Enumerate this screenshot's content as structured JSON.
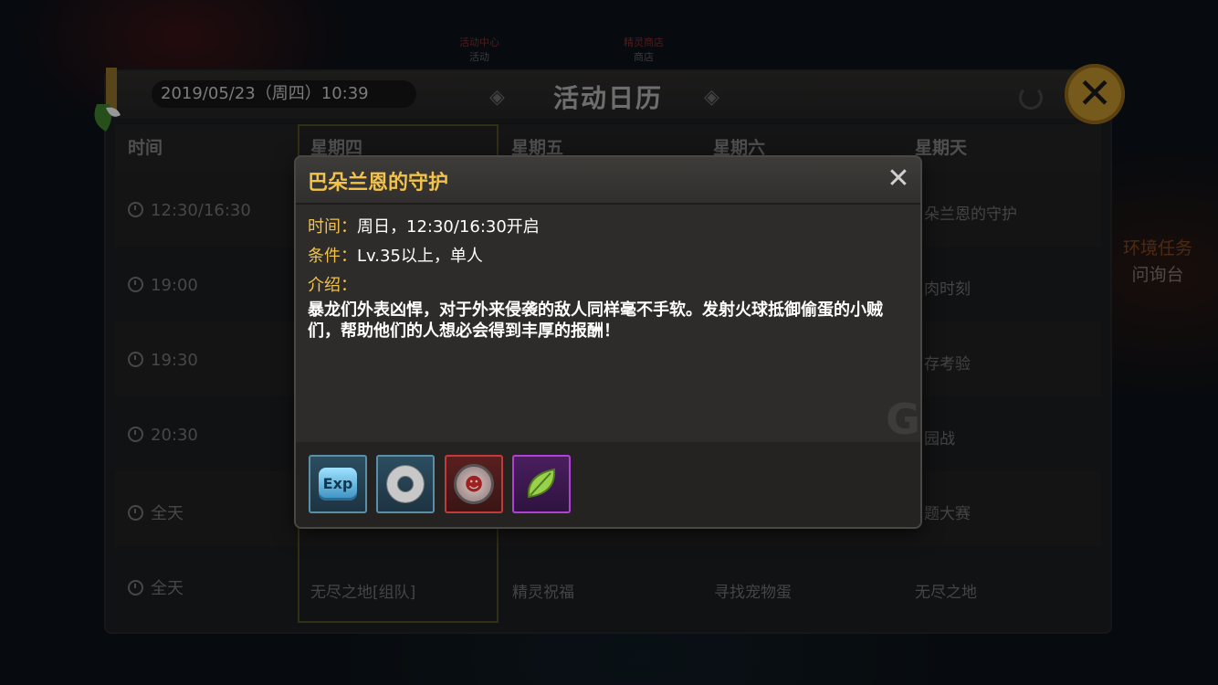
{
  "background": {
    "top_tabs": [
      {
        "line1": "活动中心",
        "line2": "活动"
      },
      {
        "line1": "精灵商店",
        "line2": "商店"
      }
    ],
    "side_button": {
      "line1": "环境任务",
      "line2": "问询台"
    }
  },
  "calendar": {
    "date": "2019/05/23（周四）10:39",
    "title": "活动日历",
    "columns": [
      "时间",
      "星期四",
      "星期五",
      "星期六",
      "星期天"
    ],
    "rows": [
      {
        "time": "12:30/16:30",
        "thu": "",
        "fri": "",
        "sat": "",
        "sun": "巴朵兰恩的守护"
      },
      {
        "time": "19:00",
        "thu": "",
        "fri": "",
        "sat": "",
        "sun": "烤肉时刻"
      },
      {
        "time": "19:30",
        "thu": "",
        "fri": "",
        "sat": "",
        "sun": "生存考验"
      },
      {
        "time": "20:30",
        "thu": "",
        "fri": "",
        "sat": "",
        "sun": "乐园战"
      },
      {
        "time": "全天",
        "thu": "",
        "fri": "",
        "sat": "",
        "sun": "问题大赛"
      },
      {
        "time": "全天",
        "thu": "无尽之地[组队]",
        "fri": "精灵祝福",
        "sat": "寻找宠物蛋",
        "sun": "无尽之地"
      }
    ],
    "visible_sun": [
      "朵兰恩的守护",
      "肉时刻",
      "存考验",
      "园战",
      "题大赛",
      "无尽之地"
    ]
  },
  "popup": {
    "title": "巴朵兰恩的守护",
    "time_key": "时间：",
    "time_value": "周日，12:30/16:30开启",
    "cond_key": "条件：",
    "cond_value": "Lv.35以上，单人",
    "intro_key": "介绍：",
    "description": "暴龙们外表凶悍，对于外来侵袭的敌人同样毫不手软。发射火球抵御偷蛋的小贼们，帮助他们的人想必会得到丰厚的报酬！",
    "close_symbol": "✕",
    "rewards": [
      {
        "icon": "exp-icon",
        "label": "Exp",
        "color": "#5a8fa8"
      },
      {
        "icon": "ring-icon",
        "label": "",
        "color": "#5a8fa8"
      },
      {
        "icon": "dragon-badge-icon",
        "label": "",
        "color": "#c23a3a"
      },
      {
        "icon": "leaf-icon",
        "label": "",
        "color": "#b23fd6"
      }
    ]
  }
}
